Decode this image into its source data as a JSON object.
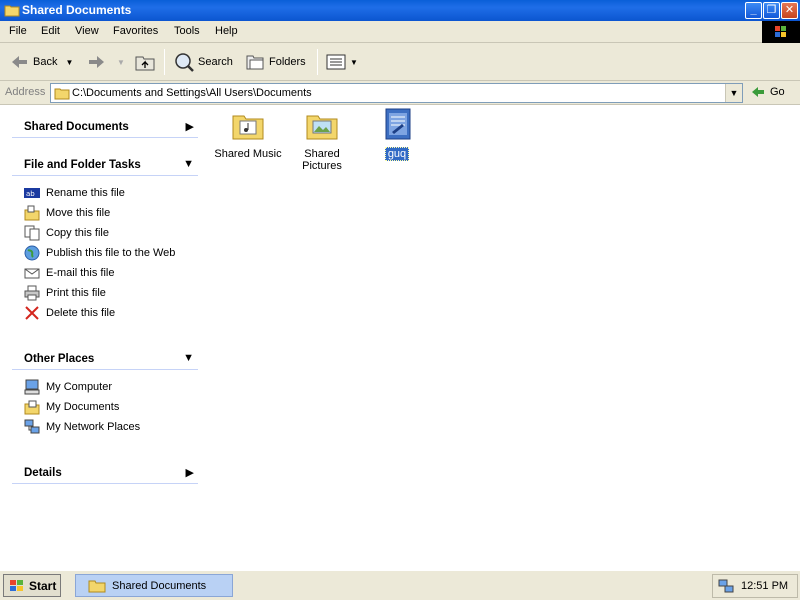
{
  "window": {
    "title": "Shared Documents",
    "controls": {
      "minimize": "_",
      "maximize": "❐",
      "close": "✕"
    }
  },
  "menu": [
    "File",
    "Edit",
    "View",
    "Favorites",
    "Tools",
    "Help"
  ],
  "toolbar": {
    "back": "Back",
    "search": "Search",
    "folders": "Folders"
  },
  "address": {
    "label": "Address",
    "value": "C:\\Documents and Settings\\All Users\\Documents",
    "go": "Go"
  },
  "taskpane": {
    "section1": "Shared Documents",
    "section2": "File and Folder Tasks",
    "tasks": [
      "Rename this file",
      "Move this file",
      "Copy this file",
      "Publish this file to the Web",
      "E-mail this file",
      "Print this file",
      "Delete this file"
    ],
    "section3": "Other Places",
    "places": [
      "My Computer",
      "My Documents",
      "My Network Places"
    ],
    "section4": "Details"
  },
  "files": [
    {
      "name": "Shared Music"
    },
    {
      "name": "Shared Pictures"
    },
    {
      "name": "guq",
      "selected": true
    }
  ],
  "taskbar": {
    "start": "Start",
    "active_task": "Shared Documents",
    "clock": "12:51 PM"
  },
  "colors": {
    "titlebar": "#0a5fd8",
    "selection": "#316ac5",
    "pane_border": "#c6d3f7"
  }
}
